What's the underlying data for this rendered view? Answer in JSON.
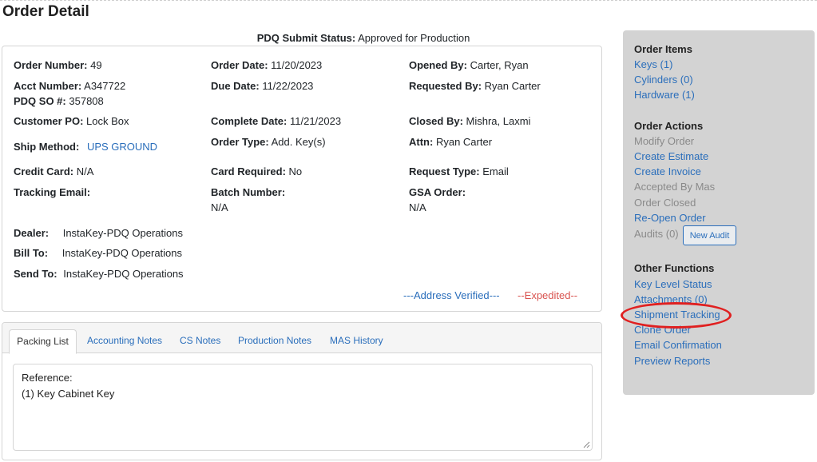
{
  "page": {
    "title": "Order Detail"
  },
  "submit_status": {
    "label": "PDQ Submit Status:",
    "value": "Approved for Production"
  },
  "order": {
    "order_number_label": "Order Number:",
    "order_number": "49",
    "order_date_label": "Order Date:",
    "order_date": "11/20/2023",
    "opened_by_label": "Opened By:",
    "opened_by": "Carter, Ryan",
    "acct_number_label": "Acct Number:",
    "acct_number": "A347722",
    "pdq_so_label": "PDQ SO #:",
    "pdq_so": "357808",
    "due_date_label": "Due Date:",
    "due_date": "11/22/2023",
    "requested_by_label": "Requested By:",
    "requested_by": "Ryan Carter",
    "customer_po_label": "Customer PO:",
    "customer_po": "Lock Box",
    "complete_date_label": "Complete Date:",
    "complete_date": "11/21/2023",
    "closed_by_label": "Closed By:",
    "closed_by": "Mishra, Laxmi",
    "ship_method_label": "Ship Method:",
    "ship_method": "UPS GROUND",
    "order_type_label": "Order Type:",
    "order_type": "Add. Key(s)",
    "attn_label": "Attn:",
    "attn": "Ryan Carter",
    "credit_card_label": "Credit Card:",
    "credit_card": "N/A",
    "card_required_label": "Card Required:",
    "card_required": "No",
    "request_type_label": "Request Type:",
    "request_type": "Email",
    "tracking_email_label": "Tracking Email:",
    "batch_number_label": "Batch Number:",
    "batch_number": "N/A",
    "gsa_order_label": "GSA Order:",
    "gsa_order": "N/A",
    "dealer_label": "Dealer:",
    "dealer": "InstaKey-PDQ Operations",
    "bill_to_label": "Bill To:",
    "bill_to": "InstaKey-PDQ Operations",
    "send_to_label": "Send To:",
    "send_to": "InstaKey-PDQ Operations",
    "address_verified": "---Address Verified---",
    "expedited": "--Expedited--"
  },
  "tabs": [
    {
      "label": "Packing List",
      "active": true
    },
    {
      "label": "Accounting Notes"
    },
    {
      "label": "CS Notes"
    },
    {
      "label": "Production Notes"
    },
    {
      "label": "MAS History"
    }
  ],
  "notes": {
    "line1": "Reference:",
    "line2": "(1) Key Cabinet Key"
  },
  "sidebar": {
    "order_items": {
      "heading": "Order Items",
      "keys": "Keys (1)",
      "cylinders": "Cylinders (0)",
      "hardware": "Hardware (1)"
    },
    "order_actions": {
      "heading": "Order Actions",
      "modify_order": "Modify Order",
      "create_estimate": "Create Estimate",
      "create_invoice": "Create Invoice",
      "accepted_by_mas": "Accepted By Mas",
      "order_closed": "Order Closed",
      "reopen_order": "Re-Open Order",
      "audits": "Audits (0)",
      "new_audit": "New Audit"
    },
    "other_functions": {
      "heading": "Other Functions",
      "key_level_status": "Key Level Status",
      "attachments": "Attachments (0)",
      "shipment_tracking": "Shipment Tracking",
      "clone_order": "Clone Order",
      "email_confirmation": "Email Confirmation",
      "preview_reports": "Preview Reports"
    }
  },
  "colors": {
    "link": "#2a6ebb",
    "expedited": "#d9534f",
    "panel": "#d3d3d3",
    "highlight": "#e02020"
  }
}
